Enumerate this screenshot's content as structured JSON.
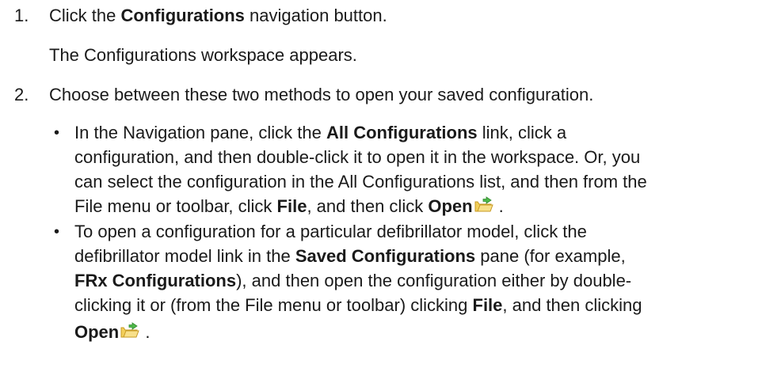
{
  "steps": [
    {
      "number": "1.",
      "text_before": "Click the ",
      "bold": "Configurations",
      "text_after": " navigation button.",
      "result": "The Configurations workspace appears."
    },
    {
      "number": "2.",
      "text": "Choose between these two methods to open your saved configuration.",
      "bullets": [
        {
          "symbol": "•",
          "l1_a": "In the Navigation pane, click the ",
          "l1_b": "All Configurations",
          "l1_c": " link, click a",
          "l2": "configuration, and then double-click it to open it in the workspace. Or, you",
          "l3": "can select the configuration in the All Configurations list, and then from the",
          "l4_a": "File menu or toolbar, click ",
          "l4_b": "File",
          "l4_c": ", and then click ",
          "l4_d": "Open",
          "l4_e": " ."
        },
        {
          "symbol": "•",
          "l1": "To open a configuration for a particular defibrillator model, click the",
          "l2_a": "defibrillator model link in the ",
          "l2_b": "Saved Configurations",
          "l2_c": " pane (for example,",
          "l3_a": "FRx Configurations",
          "l3_b": "), and then open the configuration either by double-",
          "l4_a": "clicking it or (from the File menu or toolbar) clicking ",
          "l4_b": "File",
          "l4_c": ", and then clicking",
          "l5_a": "Open",
          "l5_b": " ."
        }
      ]
    }
  ],
  "icons": {
    "open": "open-folder-icon"
  }
}
